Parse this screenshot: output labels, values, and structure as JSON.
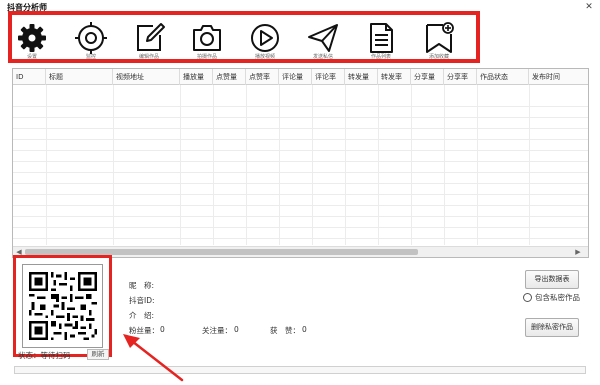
{
  "window": {
    "title": "抖音分析师",
    "close_glyph": "✕"
  },
  "toolbar": {
    "items": [
      {
        "icon": "gear-icon",
        "caption": "设置"
      },
      {
        "icon": "target-icon",
        "caption": "监控"
      },
      {
        "icon": "edit-icon",
        "caption": "编辑作品"
      },
      {
        "icon": "camera-icon",
        "caption": "拍摄作品"
      },
      {
        "icon": "play-icon",
        "caption": "播放视频"
      },
      {
        "icon": "send-icon",
        "caption": "发送私信"
      },
      {
        "icon": "document-icon",
        "caption": "作品列表"
      },
      {
        "icon": "add-bookmark-icon",
        "caption": "添加收藏"
      }
    ],
    "highlight_color": "#e52421"
  },
  "table": {
    "columns": [
      "ID",
      "标题",
      "视频地址",
      "播放量",
      "点赞量",
      "点赞率",
      "评论量",
      "评论率",
      "转发量",
      "转发率",
      "分享量",
      "分享率",
      "作品状态",
      "发布时间"
    ],
    "rows": []
  },
  "profile": {
    "nickname_label": "昵　称:",
    "nickname_value": "",
    "douyin_id_label": "抖音ID:",
    "douyin_id_value": "",
    "intro_label": "介　绍:",
    "intro_value": "",
    "fans_label": "粉丝量：",
    "fans_value": "0",
    "follow_label": "关注量：",
    "follow_value": "0",
    "likes_label": "获　赞：",
    "likes_value": "0"
  },
  "status": {
    "text": "状态：等待扫码",
    "refresh_label": "刷新"
  },
  "actions": {
    "export_label": "导出数据表",
    "include_private_label": "包含私密作品",
    "include_private_checked": false,
    "delete_private_label": "删除私密作品"
  },
  "annotation": {
    "color": "#e52421"
  }
}
